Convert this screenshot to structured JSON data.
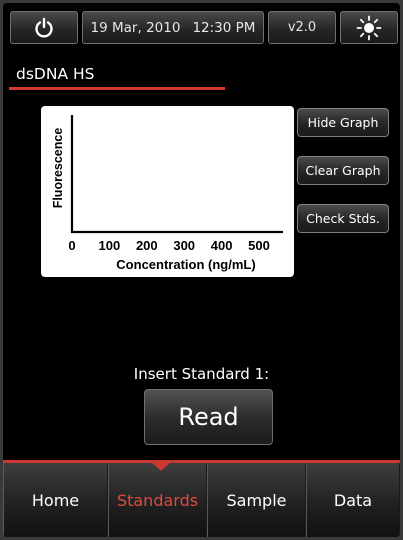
{
  "topbar": {
    "power_icon": "power-icon",
    "date": "19 Mar, 2010",
    "time": "12:30 PM",
    "version": "v2.0",
    "brightness_icon": "sun-icon"
  },
  "assay": {
    "title": "dsDNA HS",
    "accent": "#d43a30"
  },
  "chart_data": {
    "type": "scatter",
    "title": "",
    "xlabel": "Concentration (ng/mL)",
    "ylabel": "Fluorescence",
    "xticks": [
      "0",
      "100",
      "200",
      "300",
      "400",
      "500"
    ],
    "xlim": [
      0,
      500
    ],
    "series": [],
    "grid": false
  },
  "graph_buttons": {
    "hide": "Hide Graph",
    "clear": "Clear Graph",
    "check": "Check Stds."
  },
  "prompt": "Insert Standard 1:",
  "read_label": "Read",
  "nav": {
    "home": "Home",
    "standards": "Standards",
    "sample": "Sample",
    "data": "Data",
    "active": "Standards"
  }
}
